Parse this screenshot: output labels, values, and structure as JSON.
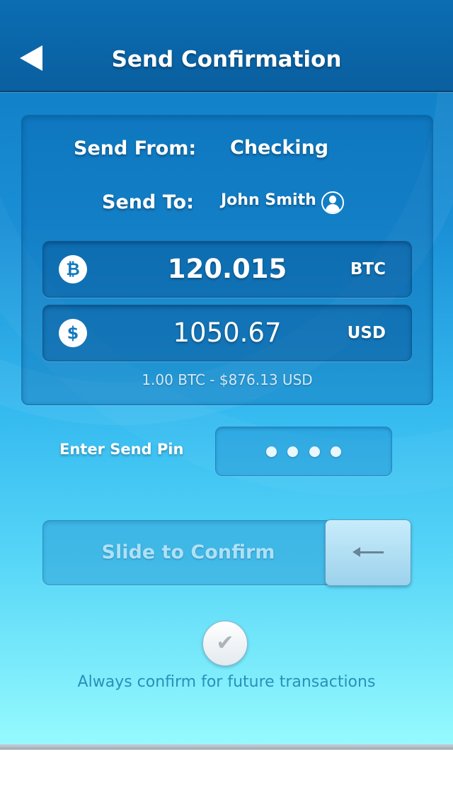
{
  "header": {
    "title": "Send Confirmation"
  },
  "send": {
    "from_label": "Send From:",
    "from_value": "Checking",
    "to_label": "Send To:",
    "to_value": "John Smith"
  },
  "amounts": {
    "btc_icon": "₿",
    "btc_value": "120.015",
    "btc_code": "BTC",
    "usd_icon": "$",
    "usd_value": "1050.67",
    "usd_code": "USD",
    "rate": "1.00 BTC - $876.13 USD"
  },
  "pin": {
    "label": "Enter Send Pin",
    "digits_entered": 4
  },
  "slider": {
    "label": "Slide to Confirm"
  },
  "confirm": {
    "check_glyph": "✔",
    "text": "Always confirm for future transactions"
  },
  "colors": {
    "header_bg": "#0b6db3",
    "gradient_top": "#0c78c0",
    "gradient_bottom": "#97fbfe",
    "text_primary": "#ffffff",
    "footer_text": "#2a8fb9"
  },
  "icons": {
    "back": "back-arrow-icon",
    "contact": "person-icon",
    "bitcoin": "bitcoin-icon",
    "dollar": "dollar-icon",
    "slider_handle": "left-arrow-icon",
    "checkbox": "checkmark-icon"
  }
}
